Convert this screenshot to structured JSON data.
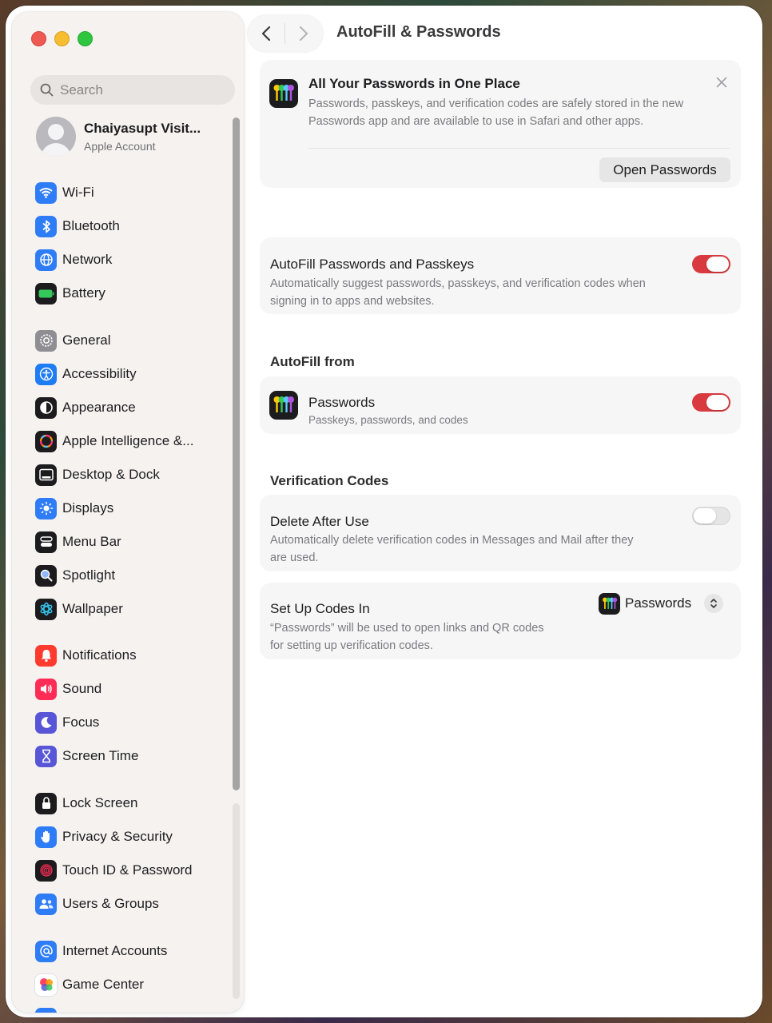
{
  "window": {
    "title": "AutoFill & Passwords"
  },
  "search": {
    "placeholder": "Search"
  },
  "account": {
    "name": "Chaiyasupt Visit...",
    "subtitle": "Apple Account"
  },
  "sidebar": {
    "items": [
      {
        "label": "Wi-Fi",
        "icon": "wifi-icon",
        "color": "#2f7df6"
      },
      {
        "label": "Bluetooth",
        "icon": "bluetooth-icon",
        "color": "#2f7df6"
      },
      {
        "label": "Network",
        "icon": "globe-icon",
        "color": "#2f7df6"
      },
      {
        "label": "Battery",
        "icon": "battery-icon",
        "color": "#34c759"
      },
      {
        "label": "General",
        "icon": "gear-icon",
        "color": "#8e8e93"
      },
      {
        "label": "Accessibility",
        "icon": "accessibility-icon",
        "color": "#1e7cf5"
      },
      {
        "label": "Appearance",
        "icon": "appearance-icon",
        "color": "#1c1c1e"
      },
      {
        "label": "Apple Intelligence &...",
        "icon": "apple-intelligence-icon",
        "color": "#ff9500"
      },
      {
        "label": "Desktop & Dock",
        "icon": "dock-icon",
        "color": "#1c1c1e"
      },
      {
        "label": "Displays",
        "icon": "sun-icon",
        "color": "#2f7df6"
      },
      {
        "label": "Menu Bar",
        "icon": "menubar-icon",
        "color": "#1c1c1e"
      },
      {
        "label": "Spotlight",
        "icon": "spotlight-icon",
        "color": "#1c1c1e"
      },
      {
        "label": "Wallpaper",
        "icon": "flower-icon",
        "color": "#35c1e8"
      },
      {
        "label": "Notifications",
        "icon": "bell-icon",
        "color": "#ff3b30"
      },
      {
        "label": "Sound",
        "icon": "speaker-icon",
        "color": "#ff2d55"
      },
      {
        "label": "Focus",
        "icon": "moon-icon",
        "color": "#5856d6"
      },
      {
        "label": "Screen Time",
        "icon": "hourglass-icon",
        "color": "#5856d6"
      },
      {
        "label": "Lock Screen",
        "icon": "lock-icon",
        "color": "#1c1c1e"
      },
      {
        "label": "Privacy & Security",
        "icon": "hand-icon",
        "color": "#2f7df6"
      },
      {
        "label": "Touch ID & Password",
        "icon": "fingerprint-icon",
        "color": "#ff2d55"
      },
      {
        "label": "Users & Groups",
        "icon": "users-icon",
        "color": "#2f7df6"
      },
      {
        "label": "Internet Accounts",
        "icon": "at-icon",
        "color": "#2f7df6"
      },
      {
        "label": "Game Center",
        "icon": "game-center-icon",
        "color": "#ff2d55"
      }
    ]
  },
  "banner": {
    "title": "All Your Passwords in One Place",
    "desc_line1": "Passwords, passkeys, and verification codes are safely stored in the new",
    "desc_line2": "Passwords app and are available to use in Safari and other apps.",
    "button": "Open Passwords"
  },
  "autofill": {
    "title": "AutoFill Passwords and Passkeys",
    "desc_line1": "Automatically suggest passwords, passkeys, and verification codes when",
    "desc_line2": "signing in to apps and websites.",
    "enabled": true
  },
  "autofill_from": {
    "section": "AutoFill from",
    "title": "Passwords",
    "desc": "Passkeys, passwords, and codes",
    "enabled": true
  },
  "verification": {
    "section": "Verification Codes",
    "delete_title": "Delete After Use",
    "delete_desc_line1": "Automatically delete verification codes in Messages and Mail after they",
    "delete_desc_line2": "are used.",
    "delete_enabled": false,
    "setup_title": "Set Up Codes In",
    "setup_desc_line1": "“Passwords” will be used to open links and QR codes",
    "setup_desc_line2": "for setting up verification codes.",
    "setup_value": "Passwords"
  },
  "colors": {
    "accent": "#d93a3f"
  }
}
